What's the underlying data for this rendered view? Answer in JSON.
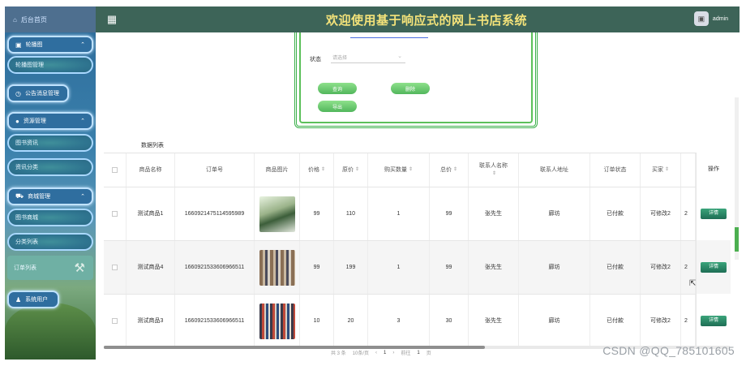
{
  "header": {
    "home_label": "后台首页",
    "title": "欢迎使用基于响应式的网上书店系统",
    "user": "admin",
    "accent": "#f4e37a"
  },
  "sidebar": {
    "items": [
      {
        "label": "轮播图",
        "type": "parent"
      },
      {
        "label": "轮播图管理",
        "type": "child"
      },
      {
        "label": "公告消息管理",
        "type": "parent"
      },
      {
        "label": "资源管理",
        "type": "parent"
      },
      {
        "label": "图书资讯",
        "type": "child"
      },
      {
        "label": "资讯分类",
        "type": "child"
      },
      {
        "label": "商城管理",
        "type": "parent"
      },
      {
        "label": "图书商城",
        "type": "child"
      },
      {
        "label": "分类列表",
        "type": "child"
      },
      {
        "label": "订单列表",
        "type": "active"
      },
      {
        "label": "系统用户",
        "type": "parent"
      }
    ]
  },
  "search": {
    "status_label": "状态",
    "status_placeholder": "请选择",
    "query_button": "查询",
    "delete_button": "删除",
    "export_button": "导出"
  },
  "table": {
    "title": "数据列表",
    "columns": [
      "商品名称",
      "订单号",
      "商品图片",
      "价格",
      "原价",
      "购买数量",
      "总价",
      "联系人名称",
      "联系人地址",
      "订单状态",
      "买家",
      "操作"
    ],
    "rows": [
      {
        "name": "测试商品1",
        "order_no": "1660921475114595989",
        "price": "99",
        "original": "110",
        "qty": "1",
        "total": "99",
        "contact": "张先生",
        "address": "廊坊",
        "status": "已付款",
        "buyer": "可修改2",
        "extra": "2",
        "op": "详情"
      },
      {
        "name": "测试商品4",
        "order_no": "1660921533606966511",
        "price": "99",
        "original": "199",
        "qty": "1",
        "total": "99",
        "contact": "张先生",
        "address": "廊坊",
        "status": "已付款",
        "buyer": "可修改2",
        "extra": "2",
        "op": "详情"
      },
      {
        "name": "测试商品3",
        "order_no": "1660921533606966511",
        "price": "10",
        "original": "20",
        "qty": "3",
        "total": "30",
        "contact": "张先生",
        "address": "廊坊",
        "status": "已付款",
        "buyer": "可修改2",
        "extra": "2",
        "op": "详情"
      }
    ]
  },
  "pager": {
    "total": "共 3 条",
    "page_size": "10条/页",
    "current": "1",
    "goto": "前往",
    "goto_value": "1",
    "page_unit": "页"
  },
  "watermark": "CSDN @QQ_785101605"
}
